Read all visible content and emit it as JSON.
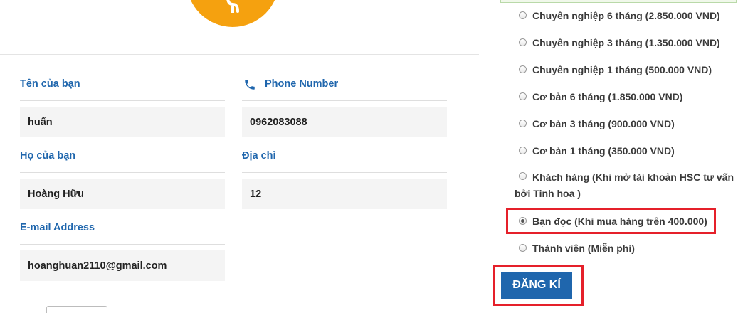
{
  "form": {
    "first_name": {
      "label": "Tên của bạn",
      "value": "huấn"
    },
    "phone": {
      "label": "Phone Number",
      "value": "0962083088"
    },
    "last_name": {
      "label": "Họ của bạn",
      "value": "Hoàng Hữu"
    },
    "address": {
      "label": "Địa chỉ",
      "value": "12"
    },
    "email": {
      "label": "E-mail Address",
      "value": "hoanghuan2110@gmail.com"
    }
  },
  "plans": {
    "options": [
      {
        "label": "Chuyên nghiệp 6 tháng (2.850.000 VND)",
        "checked": false
      },
      {
        "label": "Chuyên nghiệp 3 tháng (1.350.000 VND)",
        "checked": false
      },
      {
        "label": "Chuyên nghiệp 1 tháng (500.000 VND)",
        "checked": false
      },
      {
        "label": "Cơ bản 6 tháng (1.850.000 VND)",
        "checked": false
      },
      {
        "label": "Cơ bản 3 tháng (900.000 VND)",
        "checked": false
      },
      {
        "label": "Cơ bản 1 tháng (350.000 VND)",
        "checked": false
      },
      {
        "label_line1": "Khách hàng (Khi mở tài khoản HSC tư vấn",
        "label_line2": "bởi Tinh hoa )",
        "checked": false
      },
      {
        "label": "Bạn đọc (Khi mua hàng trên 400.000)",
        "checked": true
      },
      {
        "label": "Thành viên (Miễn phí)",
        "checked": false
      }
    ],
    "selected_index": 7
  },
  "register_button": {
    "label": "ĐĂNG KÍ"
  },
  "colors": {
    "accent": "#1f66ad",
    "coin": "#f5a10f",
    "highlight": "#e5202a"
  },
  "icons": {
    "coin": "dollar-coin-icon",
    "phone": "phone-icon"
  }
}
